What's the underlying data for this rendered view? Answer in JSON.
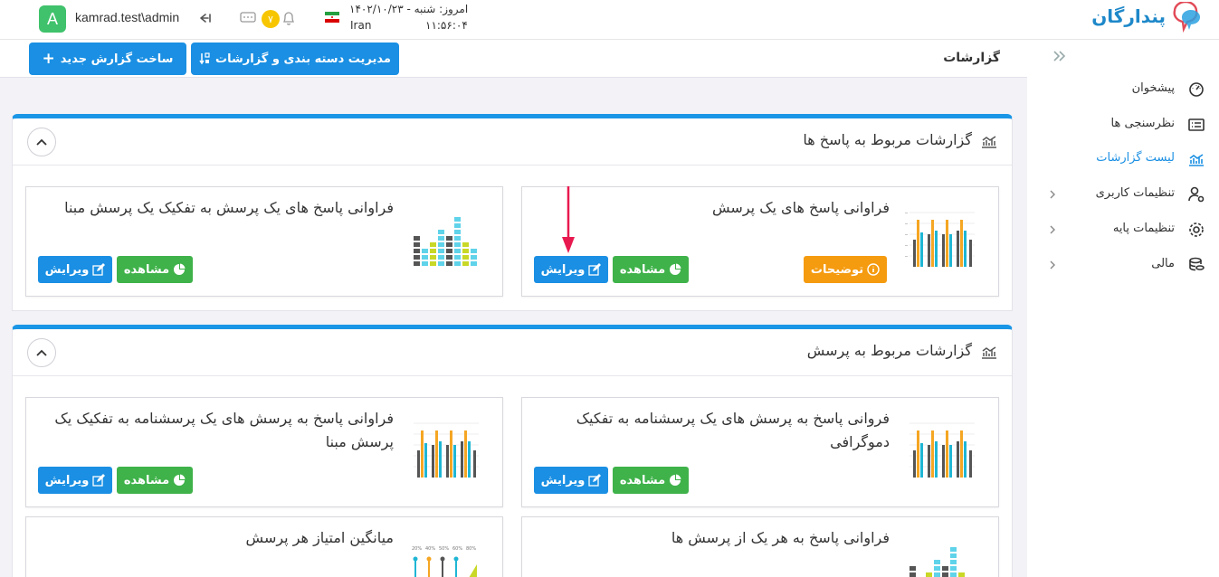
{
  "header": {
    "avatar_letter": "A",
    "username": "kamrad.test\\admin",
    "notification_count": "۷",
    "date_text": "امروز: شنبه - ۱۴۰۲/۱۰/۲۳",
    "country": "Iran",
    "time": "۱۱:۵۶:۰۴",
    "logo_text": "پندارگان"
  },
  "toolbar": {
    "page_title": "گزارشات",
    "manage_button": "مدیریت دسته بندی و گزارشات",
    "new_report_button": "ساخت گزارش جدید"
  },
  "sidebar": {
    "items": [
      {
        "label": "پیشخوان",
        "icon": "dashboard-icon"
      },
      {
        "label": "نظرسنجی ها",
        "icon": "list-icon"
      },
      {
        "label": "لیست گزارشات",
        "icon": "chart-icon",
        "active": true
      },
      {
        "label": "تنظیمات کاربری",
        "icon": "user-settings-icon"
      },
      {
        "label": "تنظیمات پایه",
        "icon": "gear-icon"
      },
      {
        "label": "مالی",
        "icon": "coins-icon"
      }
    ]
  },
  "sections": [
    {
      "title": "گزارشات مربوط به پاسخ ها",
      "cards": [
        {
          "title": "فراوانی پاسخ های یک پرسش",
          "desc_label": "توضیحات",
          "view_label": "مشاهده",
          "edit_label": "ویرایش"
        },
        {
          "title": "فراوانی پاسخ های یک پرسش به تفکیک یک پرسش مبنا",
          "view_label": "مشاهده",
          "edit_label": "ویرایش"
        }
      ]
    },
    {
      "title": "گزارشات مربوط به پرسش",
      "cards": [
        {
          "title": "فروانی پاسخ به پرسش های یک پرسشنامه به تفکیک دموگرافی",
          "view_label": "مشاهده",
          "edit_label": "ویرایش"
        },
        {
          "title": "فراوانی پاسخ به پرسش های یک پرسشنامه به تفکیک یک پرسش مبنا",
          "view_label": "مشاهده",
          "edit_label": "ویرایش"
        },
        {
          "title": "فراوانی پاسخ به هر یک از پرسش ها"
        },
        {
          "title": "میانگین امتیاز هر پرسش",
          "thumb_labels": [
            "20%",
            "40%",
            "50%",
            "60%",
            "80%"
          ]
        }
      ]
    }
  ],
  "colors": {
    "primary": "#1a8fe3",
    "success": "#3fb24a",
    "warning": "#f59b10",
    "accent_bar": "#1a96e6"
  }
}
